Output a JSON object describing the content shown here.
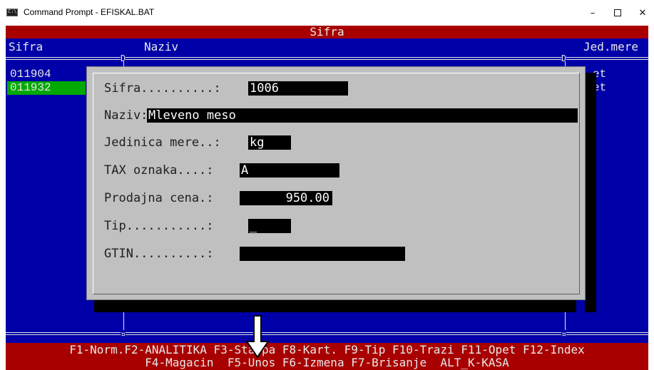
{
  "window": {
    "title": "Command Prompt - EFISKAL.BAT",
    "minimize": "–",
    "close": "✕",
    "icon": "console-icon"
  },
  "header": {
    "title": "Sifra"
  },
  "columns": {
    "sifra": "Sifra",
    "naziv": "Naziv",
    "jedmere": "Jed.mere"
  },
  "rows": [
    {
      "sifra": "011904",
      "tail": "et",
      "selected": false
    },
    {
      "sifra": "011932",
      "tail": "et",
      "selected": true
    }
  ],
  "dialog": {
    "fields": [
      {
        "label": "Sifra..........:",
        "value": "1006"
      },
      {
        "label": "Naziv:",
        "value": "Mleveno meso"
      },
      {
        "label": "Jedinica mere..:",
        "value": "kg"
      },
      {
        "label": "TAX oznaka....:",
        "value": "A"
      },
      {
        "label": "Prodajna cena.:",
        "value": "950.00"
      },
      {
        "label": "Tip...........:",
        "value": "_"
      },
      {
        "label": "GTIN..........:",
        "value": ""
      }
    ]
  },
  "menu": {
    "line1": "F1-Norm.F2-ANALITIKA F3-Stampa F8-Kart. F9-Tip F10-Trazi F11-Opet F12-Index",
    "line2": "F4-Magacin  F5-Unos F6-Izmena F7-Brisanje  ALT_K-KASA"
  },
  "colors": {
    "console_bg": "#0000a8",
    "header_bg": "#a80000",
    "selected_row": "#00a800",
    "dialog_bg": "#c0c0c0"
  }
}
